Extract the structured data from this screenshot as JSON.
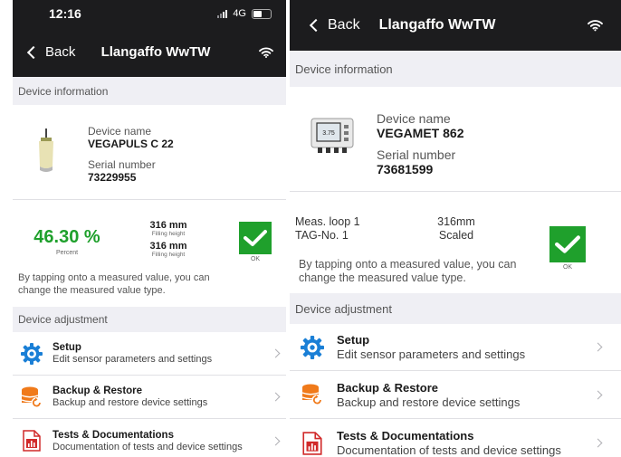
{
  "left": {
    "status": {
      "time": "12:16",
      "network": "4G"
    },
    "nav": {
      "back_label": "Back",
      "title": "Llangaffo WwTW"
    },
    "device_info_header": "Device information",
    "device": {
      "name_label": "Device name",
      "name_value": "VEGAPULS C 22",
      "serial_label": "Serial number",
      "serial_value": "73229955"
    },
    "measurement": {
      "percent_value": "46.30 %",
      "percent_label": "Percent",
      "value1": "316 mm",
      "value1_label": "Filling height",
      "value2": "316 mm",
      "value2_label": "Filling height",
      "status_label": "OK",
      "note": "By tapping onto a measured value, you can change the measured value type."
    },
    "device_adjustment_header": "Device adjustment",
    "menu": [
      {
        "title": "Setup",
        "subtitle": "Edit sensor parameters  and settings"
      },
      {
        "title": "Backup & Restore",
        "subtitle": "Backup and restore device settings"
      },
      {
        "title": "Tests & Documentations",
        "subtitle": "Documentation of tests and device settings"
      }
    ]
  },
  "right": {
    "nav": {
      "back_label": "Back",
      "title": "Llangaffo WwTW"
    },
    "device_info_header": "Device information",
    "device": {
      "name_label": "Device name",
      "name_value": "VEGAMET 862",
      "serial_label": "Serial number",
      "serial_value": "73681599",
      "display_reading": "3.75"
    },
    "measurement": {
      "loop_label": "Meas. loop 1",
      "loop_value": "316mm",
      "tag_label": "TAG-No. 1",
      "tag_value": "Scaled",
      "status_label": "OK",
      "note": "By tapping onto a measured value, you can change the measured value type."
    },
    "device_adjustment_header": "Device adjustment",
    "menu": [
      {
        "title": "Setup",
        "subtitle": "Edit sensor parameters  and settings"
      },
      {
        "title": "Backup & Restore",
        "subtitle": "Backup and restore device settings"
      },
      {
        "title": "Tests & Documentations",
        "subtitle": "Documentation of tests and device settings"
      }
    ]
  },
  "colors": {
    "nav_bg": "#1c1c1e",
    "section_bg": "#efeff4",
    "accent_green": "#1fa02c",
    "setup_blue": "#1a7fd6",
    "backup_orange": "#f07a1a",
    "docs_red": "#d12a2a"
  },
  "icons": [
    "chevron-left-icon",
    "wifi-icon",
    "sensor-icon",
    "controller-icon",
    "checkmark-icon",
    "gear-icon",
    "database-restore-icon",
    "document-chart-icon",
    "chevron-right-icon"
  ]
}
